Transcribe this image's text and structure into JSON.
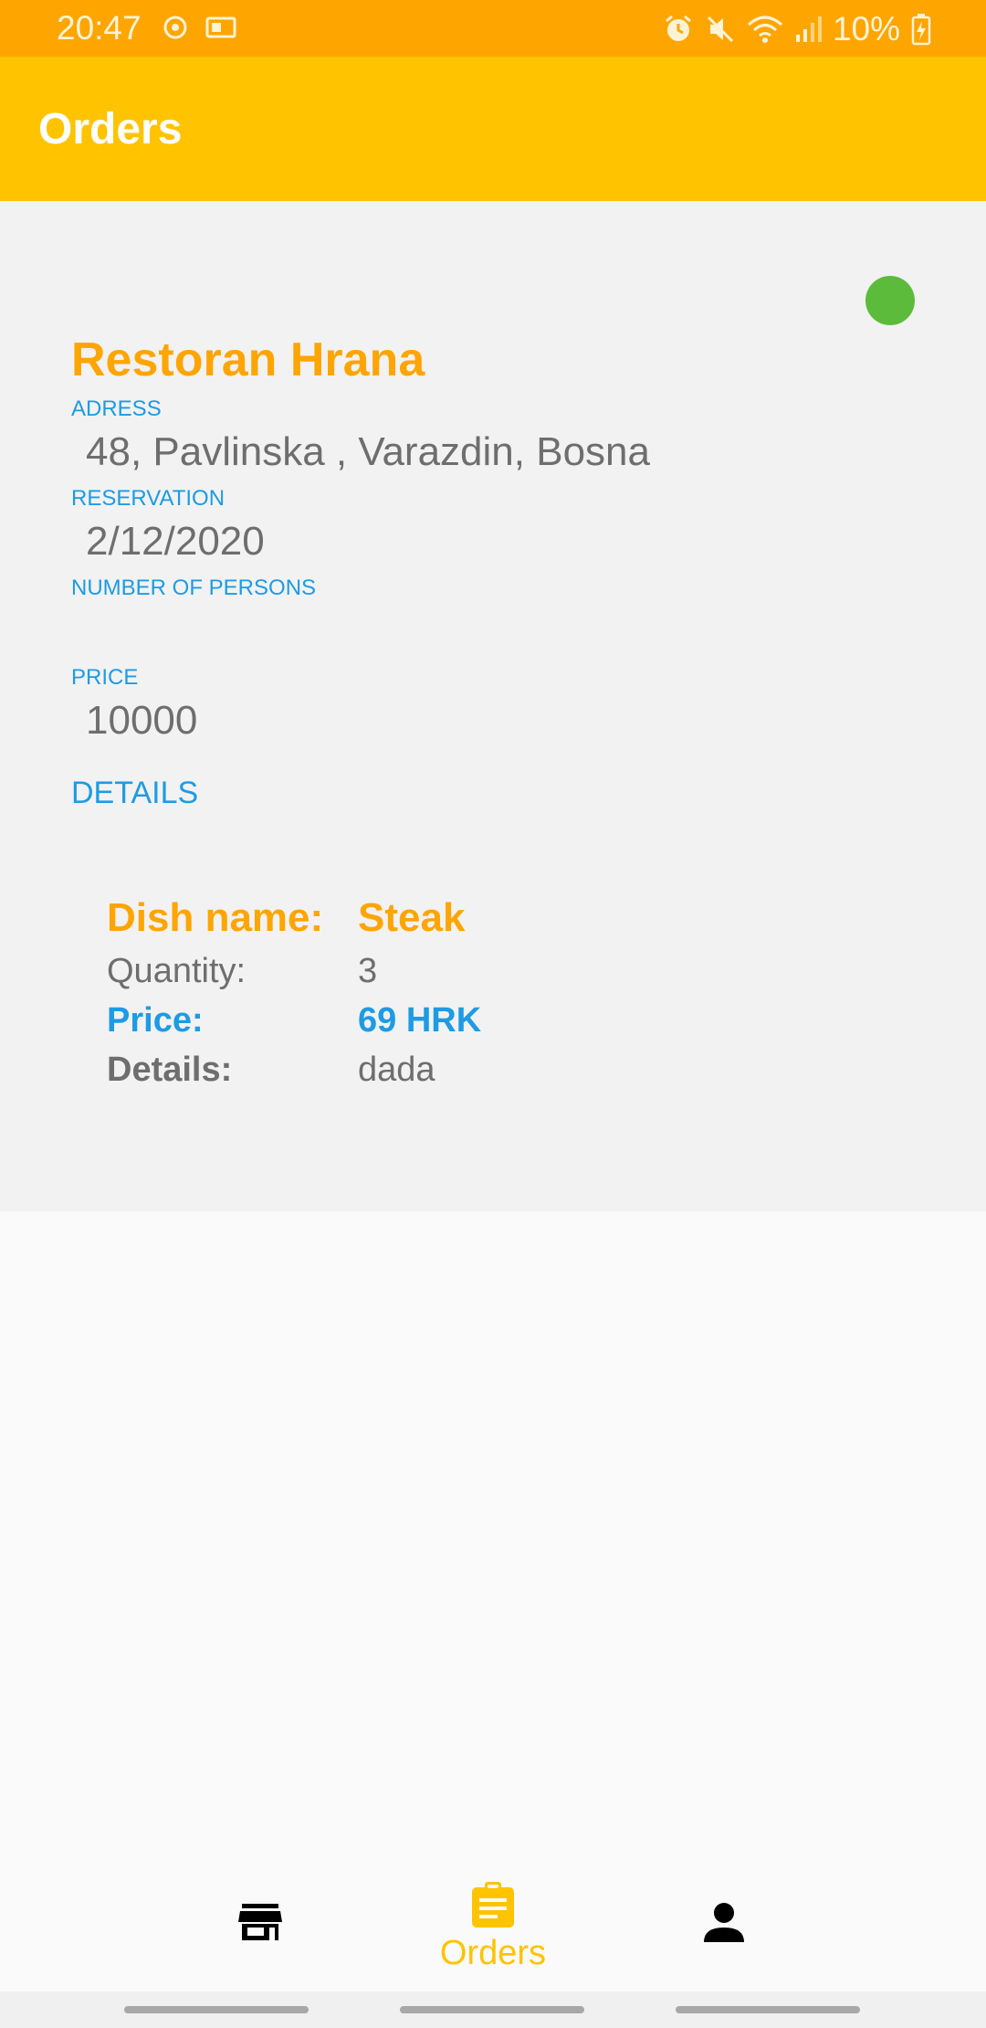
{
  "status_bar": {
    "time": "20:47",
    "battery_percent": "10%",
    "icons_left": [
      "sync-icon",
      "screen-cast-icon"
    ],
    "icons_right": [
      "alarm-icon",
      "mute-icon",
      "wifi-icon",
      "signal-icon",
      "battery-charging-icon"
    ]
  },
  "app_bar": {
    "title": "Orders"
  },
  "order": {
    "status_color": "#5DBB3C",
    "restaurant_name": "Restoran Hrana",
    "address_label": "ADRESS",
    "address_value": "48, Pavlinska , Varazdin, Bosna",
    "reservation_label": "RESERVATION",
    "reservation_value": "2/12/2020",
    "persons_label": "NUMBER OF PERSONS",
    "price_label": "PRICE",
    "price_value": "10000",
    "details_link": "DETAILS",
    "dish": {
      "name_key": "Dish name:",
      "name_value": "Steak",
      "quantity_key": "Quantity:",
      "quantity_value": "3",
      "price_key": "Price:",
      "price_value": "69 HRK",
      "details_key": "Details:",
      "details_value": "dada"
    }
  },
  "bottom_nav": {
    "items": [
      {
        "icon": "store-icon",
        "label": ""
      },
      {
        "icon": "clipboard-icon",
        "label": "Orders",
        "selected": true
      },
      {
        "icon": "person-icon",
        "label": ""
      }
    ]
  },
  "colors": {
    "status_bar": "#FFA500",
    "app_bar": "#FFC300",
    "accent_orange": "#FFA500",
    "accent_blue": "#1E9BE3",
    "text_gray": "#6E6E6E"
  }
}
